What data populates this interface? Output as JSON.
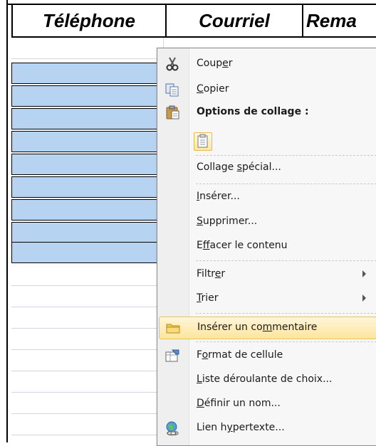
{
  "sheet": {
    "headers": [
      "Téléphone",
      "Courriel",
      "Rema"
    ]
  },
  "menu": {
    "cut": {
      "pre": "Coup",
      "ul": "e",
      "post": "r"
    },
    "copy": {
      "pre": "",
      "ul": "C",
      "post": "opier"
    },
    "paste_options": "Options de collage :",
    "paste_special": {
      "pre": "Collage ",
      "ul": "s",
      "post": "pécial..."
    },
    "insert": {
      "pre": "",
      "ul": "I",
      "post": "nsérer..."
    },
    "delete": {
      "pre": "",
      "ul": "S",
      "post": "upprimer..."
    },
    "clear": {
      "pre": "E",
      "ul": "f",
      "post": "facer le contenu"
    },
    "filter": {
      "pre": "Filtr",
      "ul": "e",
      "post": "r"
    },
    "sort": {
      "pre": "",
      "ul": "T",
      "post": "rier"
    },
    "insert_comment": {
      "pre": "Insérer un co",
      "ul": "m",
      "post": "mentaire"
    },
    "format_cells": {
      "pre": "F",
      "ul": "o",
      "post": "rmat de cellule"
    },
    "dropdown_list": {
      "pre": "",
      "ul": "L",
      "post": "iste déroulante de choix..."
    },
    "define_name": {
      "pre": "",
      "ul": "D",
      "post": "éfinir un nom..."
    },
    "hyperlink": {
      "pre": "Lien h",
      "ul": "y",
      "post": "pertexte..."
    }
  },
  "colors": {
    "selection": "#b7d3f2",
    "highlight": "#fde59e",
    "menu_bg": "#f7f7f7"
  },
  "icons": [
    "scissors-icon",
    "copy-icon",
    "clipboard-icon",
    "paste-option-icon",
    "folder-comment-icon",
    "format-cells-icon",
    "hyperlink-globe-icon"
  ]
}
